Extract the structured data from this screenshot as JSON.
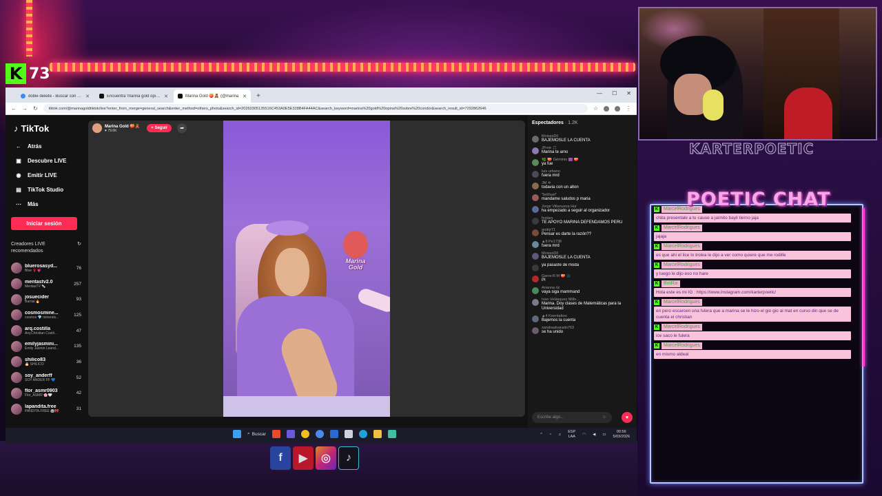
{
  "kick": {
    "icon": "kick-logo-icon",
    "letter": "K",
    "count": "73"
  },
  "browser": {
    "tabs": [
      {
        "label": "doble deleite - Buscar con Goo",
        "active": false
      },
      {
        "label": "Encuentra 'marina gold opina o",
        "active": false
      },
      {
        "label": "Marina Gold 🍑🧸 (@marina",
        "active": true
      }
    ],
    "new_tab": "+",
    "url": "tiktok.com/@marinagoldtiktok/live?enter_from_merge=general_search&enter_method=others_photo&search_id=20260305135516C453A0E5E328B4FA44AC&search_keyword=marina%20gold%20opina%20sobre%20condor&search_result_id=7292862646"
  },
  "tiktok": {
    "logo": "TikTok",
    "nav": [
      {
        "icon": "back-arrow-icon",
        "label": "Atrás"
      },
      {
        "icon": "live-icon",
        "label": "Descubre LIVE"
      },
      {
        "icon": "broadcast-icon",
        "label": "Emitir LIVE"
      },
      {
        "icon": "studio-icon",
        "label": "TikTok Studio"
      },
      {
        "icon": "more-icon",
        "label": "Más"
      }
    ],
    "login": "Iniciar sesión",
    "recommended_title": "Creadores LIVE recomendados",
    "creators": [
      {
        "name": "bluerosasyd...",
        "sub": "Blue 🌹💗",
        "count": "76"
      },
      {
        "name": "mentastv2.0",
        "sub": "MentasTV 🍬",
        "count": "257"
      },
      {
        "name": "josuecider",
        "sub": "Barrial 🔥",
        "count": "93"
      },
      {
        "name": "cosmosmine...",
        "sub": "cosmos 💎 minerals...",
        "count": "125"
      },
      {
        "name": "arq.costilla",
        "sub": "Arq.Christian Costil...",
        "count": "47"
      },
      {
        "name": "emilyjasmini...",
        "sub": "Emily Jasmin Leand...",
        "count": "135"
      },
      {
        "name": "shilico83",
        "sub": "🎂 SHILICO",
        "count": "36"
      },
      {
        "name": "soy_anderff",
        "sub": "SOY ANDER FF 💙",
        "count": "52"
      },
      {
        "name": "flor_asmr0903",
        "sub": "Flor_ASMR 🌸🤍",
        "count": "42"
      },
      {
        "name": "lapandita.free",
        "sub": "PANDITA.FREE 🐼🎀",
        "count": "31"
      }
    ],
    "host": {
      "name": "Marina Gold 🍑🧸",
      "likes": "♥ 79.6K",
      "follow": "+ Seguir"
    },
    "sticker_text": [
      "Marina",
      "Gold"
    ],
    "chat": {
      "title": "Espectadores",
      "count": "· 1.2K",
      "messages": [
        {
          "user": "MoisesDll",
          "text": "BAJEMOSLE LA CUENTA"
        },
        {
          "user": "JFree 🎵",
          "text": "Marina te amo"
        },
        {
          "user": "🌿 🍑 Géminis 🟪 🍑",
          "text": "ya fue"
        },
        {
          "user": "luis urbano",
          "text": "fuera mrd"
        },
        {
          "user": "JM ✡",
          "text": "todavia con un alton"
        },
        {
          "user": "\"bothuel\"",
          "text": "mandame saludos p maria"
        },
        {
          "user": "Jorge Villanueva Hur",
          "text": "ha empezado a seguir al organizador"
        },
        {
          "user": "festars",
          "text": "TE APOYO MARINA DEFENDAMOS PERU"
        },
        {
          "user": "andrjr71",
          "text": "Pensar es darte la razón??"
        },
        {
          "user": "▲8 Pe1738",
          "text": "fuera mrd"
        },
        {
          "user": "MoisesDll",
          "text": "BAJEMOSLE LA CUENTA"
        },
        {
          "user": "",
          "text": "ya pasaste de moda"
        },
        {
          "user": "Garra-R.M 🍑 🌑",
          "text": "PI"
        },
        {
          "user": "Arianna riz",
          "text": "vaya siga mammand"
        },
        {
          "user": "Ivan Velásquez Millo...",
          "text": "Marina. Doy clases de Matemáticas para la Universidad"
        },
        {
          "user": "▲4 Keentattoo",
          "text": "Bajemos la cuenta"
        },
        {
          "user": "sandraalvarado763",
          "text": "se ha unido"
        }
      ],
      "input_placeholder": "Escribe algo..."
    }
  },
  "taskbar": {
    "search_label": "Buscar",
    "lang": [
      "ESP",
      "LAA"
    ],
    "time": "00:56",
    "date": "5/03/2026"
  },
  "streamer_name": "KARTERPOETIC",
  "poetic_chat": {
    "title": "POETIC CHAT",
    "messages": [
      {
        "user": "MarcelRodrigues",
        "text": "chita presentale a tu cause a jaimito bayli tierno jaja"
      },
      {
        "user": "MarcelRodrigues",
        "text": "jajaja"
      },
      {
        "user": "MarcelRodrigues",
        "text": "es que ahi el lice lo trolea le dijo a ver como quiere que me rodille"
      },
      {
        "user": "MarcelRodrigues",
        "text": "y luego le dijo eso no hare"
      },
      {
        "user": "BotRix",
        "text": "Hola este es mi IG : https://www.instagram.com/karterpoetic/"
      },
      {
        "user": "MarcelRodrigues",
        "text": "en pero escarcen una fulera que a marina se le hizo el gio gio al mat en curso din que se de cuenta el christian"
      },
      {
        "user": "MarcelRodrigues",
        "text": "ice saco le fulera"
      },
      {
        "user": "MarcelRodrigues",
        "text": "en mismo aldeal"
      }
    ]
  },
  "socials": [
    {
      "icon": "facebook-icon",
      "glyph": "f"
    },
    {
      "icon": "youtube-icon",
      "glyph": "▶"
    },
    {
      "icon": "instagram-icon",
      "glyph": "◎"
    },
    {
      "icon": "tiktok-icon",
      "glyph": "♪"
    }
  ]
}
